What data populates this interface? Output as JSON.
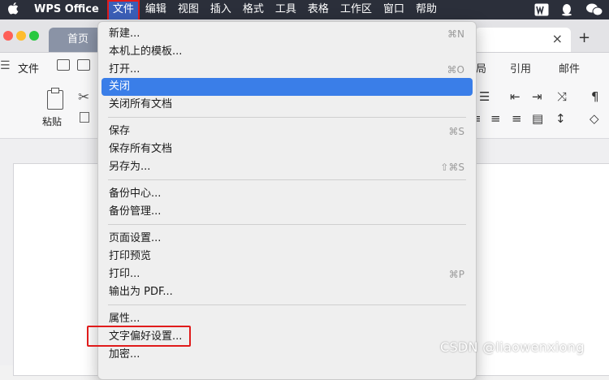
{
  "menubar": {
    "app_name": "WPS Office",
    "items": [
      "文件",
      "编辑",
      "视图",
      "插入",
      "格式",
      "工具",
      "表格",
      "工作区",
      "窗口",
      "帮助"
    ],
    "right_icons": [
      "wps-logo-icon",
      "qq-icon",
      "wechat-icon"
    ]
  },
  "tabs": {
    "home": "首页",
    "close_symbol": "×",
    "new_symbol": "+"
  },
  "ribbon": {
    "file_label": "文件",
    "tab_layout_suffix": "局",
    "tab_reference": "引用",
    "tab_mail": "邮件",
    "paste_label": "粘贴"
  },
  "file_menu": {
    "items": [
      {
        "label": "新建...",
        "shortcut": "⌘N"
      },
      {
        "label": "本机上的模板...",
        "shortcut": ""
      },
      {
        "label": "打开...",
        "shortcut": "⌘O"
      },
      {
        "label": "关闭",
        "shortcut": ""
      },
      {
        "label": "关闭所有文档",
        "shortcut": ""
      },
      {
        "label": "保存",
        "shortcut": "⌘S"
      },
      {
        "label": "保存所有文档",
        "shortcut": ""
      },
      {
        "label": "另存为...",
        "shortcut": "⇧⌘S"
      },
      {
        "label": "备份中心...",
        "shortcut": ""
      },
      {
        "label": "备份管理...",
        "shortcut": ""
      },
      {
        "label": "页面设置...",
        "shortcut": ""
      },
      {
        "label": "打印预览",
        "shortcut": ""
      },
      {
        "label": "打印...",
        "shortcut": "⌘P"
      },
      {
        "label": "输出为 PDF...",
        "shortcut": ""
      },
      {
        "label": "属性...",
        "shortcut": ""
      },
      {
        "label": "文字偏好设置...",
        "shortcut": ""
      },
      {
        "label": "加密...",
        "shortcut": ""
      }
    ],
    "highlighted_label": "关闭"
  },
  "watermark": "CSDN @liaowenxiong",
  "colors": {
    "menubar": "#2b2f3a",
    "highlight": "#3a7ee8",
    "annotation_red": "#e01b1b"
  }
}
